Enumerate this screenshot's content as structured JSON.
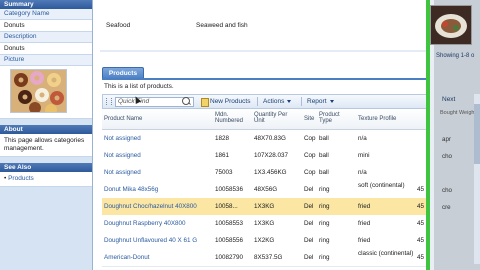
{
  "sidebar": {
    "summary_title": "Summary",
    "fields": [
      {
        "label": "Category Name",
        "value": "Donuts"
      },
      {
        "label": "Description",
        "value": "Donuts"
      }
    ],
    "picture_label": "Picture",
    "about_title": "About",
    "about_text": "This page allows categories management.",
    "see_also_title": "See Also",
    "see_also_link": "Products"
  },
  "detail": {
    "category_name": "Seafood",
    "description": "Seaweed and fish"
  },
  "products_tab": "Products",
  "list_note": "This is a list of products.",
  "toolbar": {
    "quick_find_placeholder": "Quick Find",
    "new_products": "New Products",
    "actions": "Actions",
    "report": "Report"
  },
  "grid": {
    "headers": {
      "name": "Product Name",
      "model": "Mdn. Numbered",
      "qty": "Quantity Per Unit",
      "site": "Site",
      "type": "Product Type",
      "texture": "Texture Profile"
    },
    "rows": [
      {
        "name": "Not assigned",
        "model": "1828",
        "qty": "48X70.83G",
        "site": "Cop",
        "type": "ball",
        "texture": "n/a",
        "weight": ""
      },
      {
        "name": "Not assigned",
        "model": "1861",
        "qty": "107X28.037",
        "site": "Cop",
        "type": "ball",
        "texture": "mini",
        "weight": ""
      },
      {
        "name": "Not assigned",
        "model": "75003",
        "qty": "1X3.456KG",
        "site": "Cop",
        "type": "ball",
        "texture": "n/a",
        "weight": ""
      },
      {
        "name": "Donut Mika 48x56g",
        "model": "10058536",
        "qty": "48X56G",
        "site": "Del",
        "type": "ring",
        "texture": "soft (continental)",
        "weight": "45"
      },
      {
        "name": "Doughnut Choc/hazelnut 40X800",
        "model": "10058...",
        "qty": "1X3KG",
        "site": "Del",
        "type": "ring",
        "texture": "fried",
        "weight": "45"
      },
      {
        "name": "Doughnut Raspberry 40X800",
        "model": "10058553",
        "qty": "1X3KG",
        "site": "Del",
        "type": "ring",
        "texture": "fried",
        "weight": "45"
      },
      {
        "name": "Doughnut Unflavoured 40 X 61 G",
        "model": "10058556",
        "qty": "1X2KG",
        "site": "Del",
        "type": "ring",
        "texture": "fried",
        "weight": "45"
      },
      {
        "name": "American-Donut",
        "model": "10082790",
        "qty": "8X537.5G",
        "site": "Del",
        "type": "ring",
        "texture": "classic (continental)",
        "weight": "45"
      }
    ],
    "selected_row": 4
  },
  "right_pane": {
    "showing": "Showing 1-8 o",
    "col_label": "Next",
    "col_sub": "Bought Weight",
    "values": [
      "apr",
      "cho",
      "",
      "cho",
      "cre",
      "",
      "",
      ""
    ]
  },
  "colors": {
    "accent": "#4a7fc4",
    "selection": "#fbe6a4",
    "link": "#2a5aa0",
    "green_bar": "#3ec43e"
  }
}
